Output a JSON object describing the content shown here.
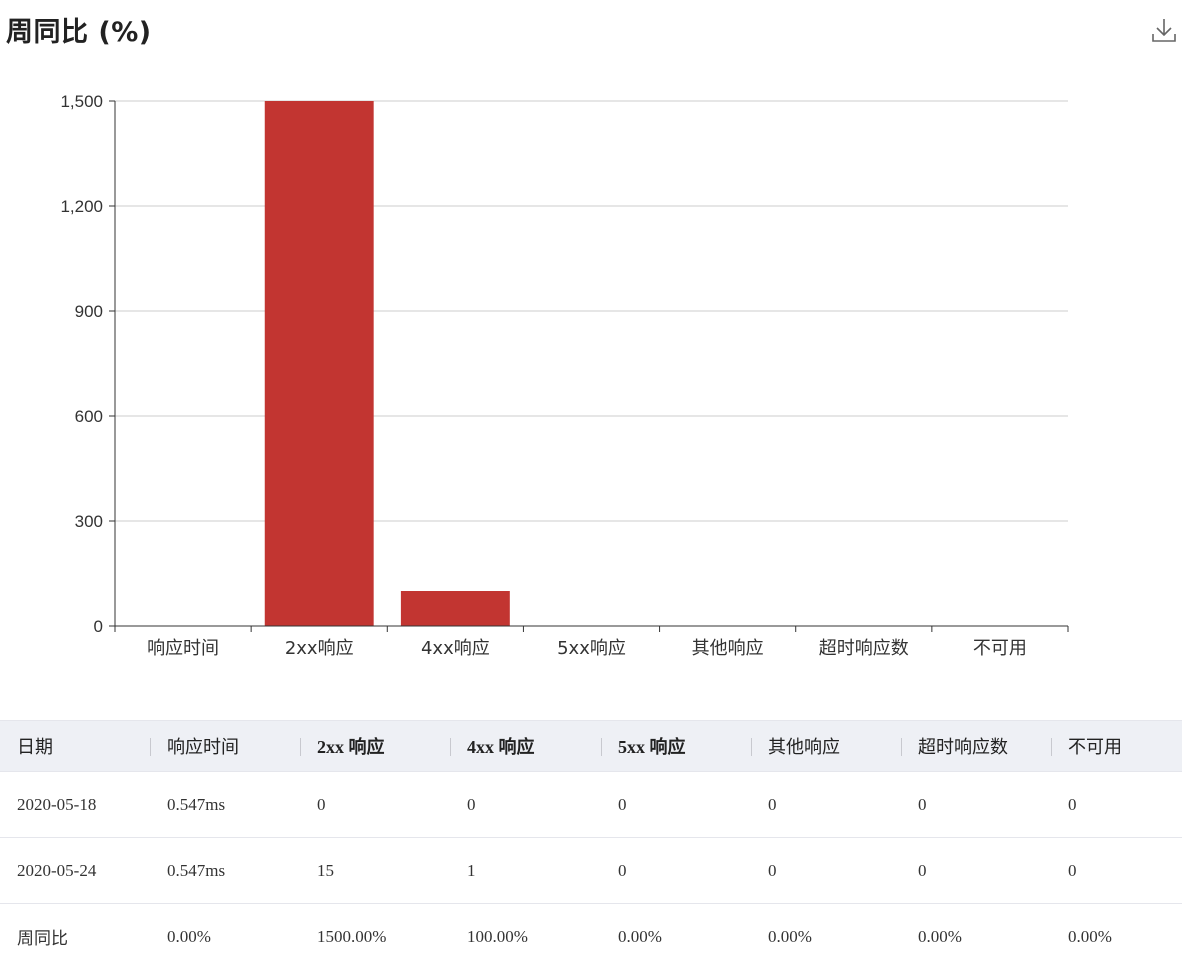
{
  "header": {
    "title": "周同比 (%)",
    "download_icon": "download-icon"
  },
  "colors": {
    "bar": "#c23531",
    "grid": "#cccccc",
    "axis": "#333333",
    "table_header_bg": "#eef0f5"
  },
  "chart_data": {
    "type": "bar",
    "title": "周同比 (%)",
    "categories": [
      "响应时间",
      "2xx响应",
      "4xx响应",
      "5xx响应",
      "其他响应",
      "超时响应数",
      "不可用"
    ],
    "values": [
      0,
      1500,
      100,
      0,
      0,
      0,
      0
    ],
    "ylim": [
      0,
      1500
    ],
    "yticks": [
      0,
      300,
      600,
      900,
      1200,
      1500
    ],
    "ytick_labels": [
      "0",
      "300",
      "600",
      "900",
      "1,200",
      "1,500"
    ],
    "grid": true,
    "legend": "none"
  },
  "table": {
    "columns": [
      "日期",
      "响应时间",
      "2xx 响应",
      "4xx 响应",
      "5xx 响应",
      "其他响应",
      "超时响应数",
      "不可用"
    ],
    "rows": [
      [
        "2020-05-18",
        "0.547ms",
        "0",
        "0",
        "0",
        "0",
        "0",
        "0"
      ],
      [
        "2020-05-24",
        "0.547ms",
        "15",
        "1",
        "0",
        "0",
        "0",
        "0"
      ],
      [
        "周同比",
        "0.00%",
        "1500.00%",
        "100.00%",
        "0.00%",
        "0.00%",
        "0.00%",
        "0.00%"
      ]
    ]
  }
}
